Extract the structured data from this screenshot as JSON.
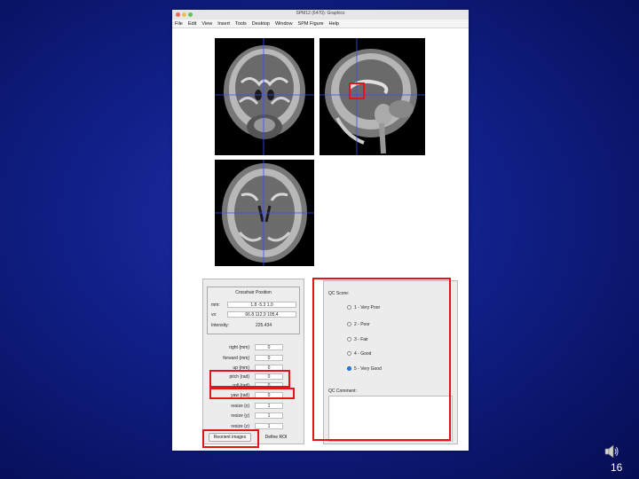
{
  "window": {
    "title": "SPM12 (6470): Graphics"
  },
  "menu": [
    "File",
    "Edit",
    "View",
    "Insert",
    "Tools",
    "Desktop",
    "Window",
    "SPM Figure",
    "Help"
  ],
  "cursor": {
    "heading": "Crosshair Position",
    "mm_label": "mm:",
    "mm_value": "1.8 -5.3 1.0",
    "vx_label": "vx:",
    "vx_value": "66.8 112.9 105.4",
    "intensity_label": "Intensity:",
    "intensity_value": "225.434"
  },
  "params": [
    {
      "label": "right  {mm}",
      "value": "0"
    },
    {
      "label": "forward  {mm}",
      "value": "0"
    },
    {
      "label": "up  {mm}",
      "value": "0"
    },
    {
      "label": "pitch  {rad}",
      "value": "0"
    },
    {
      "label": "roll  {rad}",
      "value": "0"
    },
    {
      "label": "yaw  {rad}",
      "value": "0"
    },
    {
      "label": "resize  {x}",
      "value": "1"
    },
    {
      "label": "resize  {y}",
      "value": "1"
    },
    {
      "label": "resize  {z}",
      "value": "1"
    }
  ],
  "buttons": {
    "reorient": "Reorient images",
    "define_roi": "Define ROI"
  },
  "qc": {
    "score_label": "QC Score:",
    "options": [
      "1 - Very Poor",
      "2 - Poor",
      "3 - Fair",
      "4 - Good",
      "5 - Very Good"
    ],
    "selected_index": 4,
    "comment_label": "QC Comment:",
    "comment_value": ""
  },
  "slide": {
    "page_number": "16"
  },
  "colors": {
    "highlight": "#e0141a",
    "crosshair": "#3b4cff",
    "background": "#101f86"
  },
  "icons": {
    "speaker": "speaker-icon"
  }
}
